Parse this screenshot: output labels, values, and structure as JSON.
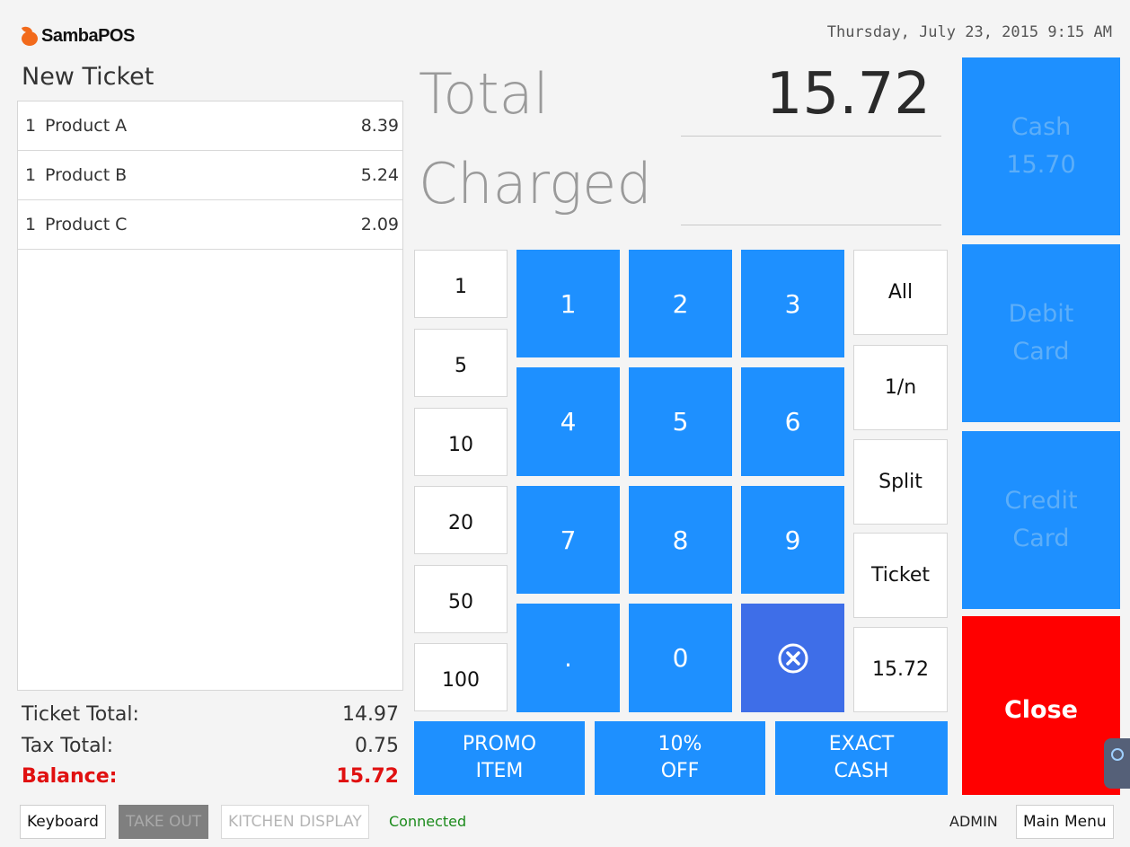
{
  "header": {
    "app_name": "SambaPOS",
    "datetime": "Thursday, July 23, 2015 9:15 AM"
  },
  "ticket": {
    "title": "New Ticket",
    "items": [
      {
        "qty": "1",
        "name": "Product A",
        "price": "8.39"
      },
      {
        "qty": "1",
        "name": "Product B",
        "price": "5.24"
      },
      {
        "qty": "1",
        "name": "Product C",
        "price": "2.09"
      }
    ],
    "summary": {
      "ticket_total_label": "Ticket Total:",
      "ticket_total_value": "14.97",
      "tax_total_label": "Tax Total:",
      "tax_total_value": "0.75",
      "balance_label": "Balance:",
      "balance_value": "15.72"
    }
  },
  "payment": {
    "total_label": "Total",
    "total_value": "15.72",
    "charged_label": "Charged",
    "charged_value": ""
  },
  "quick_amounts": [
    "1",
    "5",
    "10",
    "20",
    "50",
    "100"
  ],
  "keypad": [
    "1",
    "2",
    "3",
    "4",
    "5",
    "6",
    "7",
    "8",
    "9",
    ".",
    "0"
  ],
  "right_options": [
    "All",
    "1/n",
    "Split",
    "Ticket",
    "15.72"
  ],
  "payment_types": {
    "cash_line1": "Cash",
    "cash_line2": "15.70",
    "debit_line1": "Debit",
    "debit_line2": "Card",
    "credit_line1": "Credit",
    "credit_line2": "Card",
    "close": "Close"
  },
  "actions": {
    "promo_1": "PROMO",
    "promo_2": "ITEM",
    "off_1": "10%",
    "off_2": "OFF",
    "exact_1": "EXACT",
    "exact_2": "CASH"
  },
  "footer": {
    "keyboard": "Keyboard",
    "take_out": "TAKE OUT",
    "kitchen_display": "KITCHEN DISPLAY",
    "status": "Connected",
    "user": "ADMIN",
    "main_menu": "Main Menu"
  },
  "colors": {
    "accent": "#1e90ff",
    "close": "#ff0000",
    "balance": "#e01010",
    "status": "#1a8a1a"
  }
}
